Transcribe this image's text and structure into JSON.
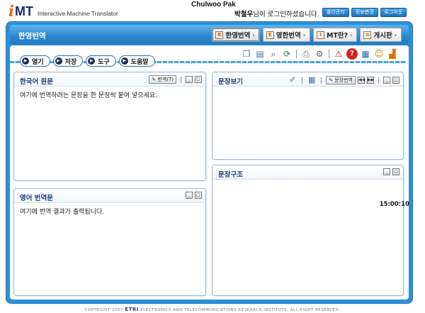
{
  "header": {
    "logo_i": "i",
    "logo_mt": "MT",
    "logo_subtitle": "Interactive Machine Translator",
    "user_name": "Chulwoo Pak",
    "login_name": "박철우",
    "login_suffix": "님이 로그인하셨습니다.",
    "buttons": [
      "폴더관리",
      "정보변경",
      "로그아웃"
    ]
  },
  "title_bar": {
    "title": "한영번역",
    "tabs": [
      {
        "label": "한영번역",
        "icon": "K",
        "active": true
      },
      {
        "label": "영한번역",
        "icon": "E",
        "active": false
      },
      {
        "label": "MT란?",
        "icon": "i",
        "active": false
      },
      {
        "label": "게시판",
        "icon": "≡",
        "active": false
      }
    ]
  },
  "toolbar": {
    "menu": [
      "열기",
      "저장",
      "도구",
      "도움말"
    ],
    "icons": [
      "copy-icon",
      "paste-icon",
      "search-icon",
      "refresh-icon",
      "print-icon",
      "settings-icon",
      "warning-icon",
      "help-icon",
      "dictionary-icon",
      "user-icon",
      "stats-icon"
    ]
  },
  "panels": {
    "source": {
      "title": "한국어 원문",
      "translate_button": "번역(T)",
      "placeholder": "여기에 번역하려는 문장을 한 문장씩 붙여 넣으세요."
    },
    "target": {
      "title": "영어 번역문",
      "placeholder": "여기에 번역 결과가 출력됩니다."
    },
    "sentence_view": {
      "title": "문장보기",
      "sentence_translate_button": "문장번역"
    },
    "sentence_structure": {
      "title": "문장구조"
    }
  },
  "time": "15:00:10",
  "footer": {
    "copyright_prefix": "COPYRIGHT 2007",
    "etri": "ETRI",
    "copyright_suffix": "ELECTRONICS AND TELECOMMUNICATIONS RESEARCH INSTITUTE. ALL RIGHT RESERVED."
  }
}
